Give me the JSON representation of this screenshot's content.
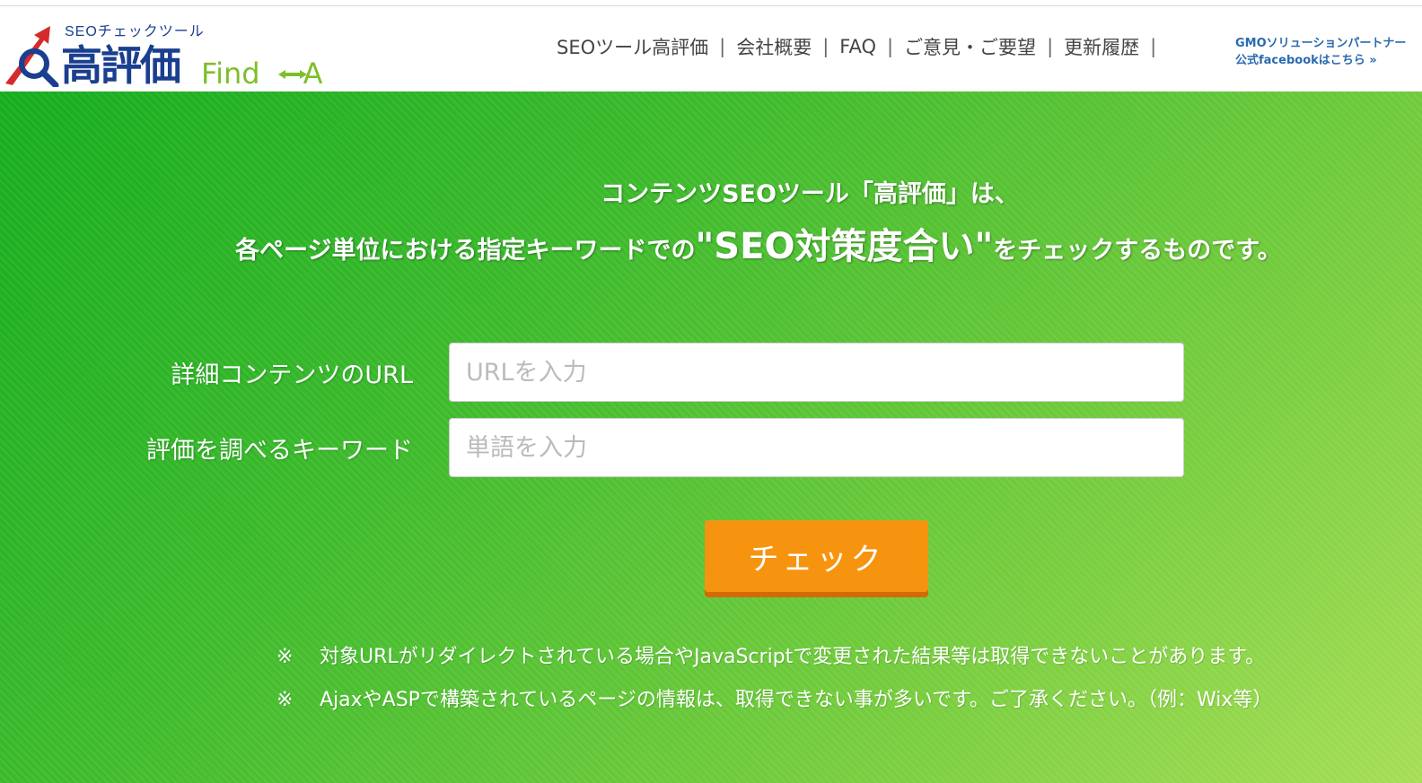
{
  "header": {
    "logo": {
      "subtitle": "SEOチェックツール",
      "title": "高評価",
      "find": "Find",
      "find_target": "A"
    },
    "nav": [
      {
        "label": "SEOツール高評価"
      },
      {
        "label": "会社概要"
      },
      {
        "label": "FAQ"
      },
      {
        "label": "ご意見・ご要望"
      },
      {
        "label": "更新履歴"
      }
    ],
    "separator": "|",
    "gmo_line1": "GMOソリューションパートナー",
    "gmo_line2": "公式facebookはこちら »"
  },
  "hero": {
    "headline1": "コンテンツSEOツール「高評価」は、",
    "headline2_pre": "各ページ単位における指定キーワードでの",
    "headline2_emph": "\"SEO対策度合い\"",
    "headline2_post": "をチェックするものです。"
  },
  "form": {
    "url_label": "詳細コンテンツのURL",
    "url_placeholder": "URLを入力",
    "url_value": "",
    "keyword_label": "評価を調べるキーワード",
    "keyword_placeholder": "単語を入力",
    "keyword_value": "",
    "submit_label": "チェック"
  },
  "notes": {
    "mark": "※",
    "note1": "対象URLがリダイレクトされている場合やJavaScriptで変更された結果等は取得できないことがあります。",
    "note2": "AjaxやASPで構築されているページの情報は、取得できない事が多いです。ご了承ください。（例：Wix等）"
  },
  "colors": {
    "brand_blue": "#1a3f8f",
    "brand_green": "#7dbf2a",
    "hero_green_start": "#16ad1f",
    "hero_green_end": "#a6de55",
    "button_orange": "#f7940f"
  }
}
